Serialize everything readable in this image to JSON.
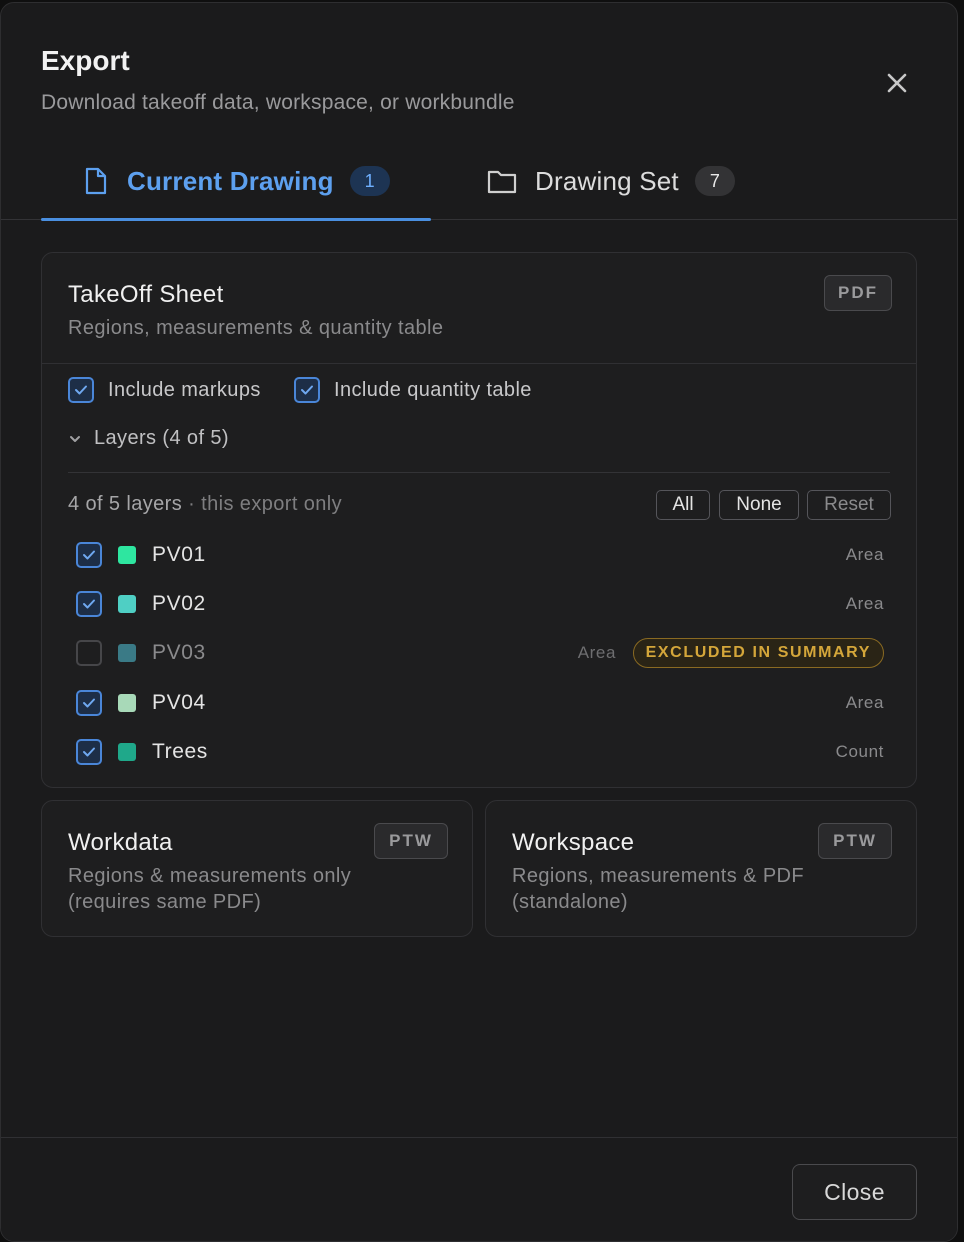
{
  "header": {
    "title": "Export",
    "subtitle": "Download takeoff data, workspace, or workbundle"
  },
  "tabs": [
    {
      "label": "Current Drawing",
      "count": "1",
      "active": true
    },
    {
      "label": "Drawing Set",
      "count": "7",
      "active": false
    }
  ],
  "takeoff": {
    "title": "TakeOff Sheet",
    "desc": "Regions, measurements & quantity table",
    "badge": "PDF",
    "include_markups": {
      "label": "Include markups",
      "checked": true
    },
    "include_table": {
      "label": "Include quantity table",
      "checked": true
    },
    "layers_toggle": "Layers (4 of 5)",
    "layers_count": "4 of 5 layers",
    "layers_scope": " · this export only",
    "btn_all": "All",
    "btn_none": "None",
    "btn_reset": "Reset",
    "layers": [
      {
        "name": "PV01",
        "type": "Area",
        "checked": true,
        "color": "#2ee6a0"
      },
      {
        "name": "PV02",
        "type": "Area",
        "checked": true,
        "color": "#4fcfc4"
      },
      {
        "name": "PV03",
        "type": "Area",
        "checked": false,
        "color": "#3a7a86",
        "pill": "EXCLUDED IN SUMMARY"
      },
      {
        "name": "PV04",
        "type": "Area",
        "checked": true,
        "color": "#a8d9b8"
      },
      {
        "name": "Trees",
        "type": "Count",
        "checked": true,
        "color": "#1fa88a"
      }
    ]
  },
  "workdata": {
    "title": "Workdata",
    "badge": "PTW",
    "desc_line1": "Regions & measurements only",
    "desc_line2": "(requires same PDF)"
  },
  "workspace": {
    "title": "Workspace",
    "badge": "PTW",
    "desc_line1": "Regions, measurements & PDF",
    "desc_line2": "(standalone)"
  },
  "footer": {
    "close_label": "Close"
  },
  "colors": {
    "accent": "#4a8fe0",
    "warning": "#d4a63a"
  },
  "icons": {
    "close": "close-icon",
    "current_drawing": "document-icon",
    "drawing_set": "folder-icon",
    "layers_toggle": "chevron-down-icon",
    "checkbox": "checkmark-icon"
  }
}
